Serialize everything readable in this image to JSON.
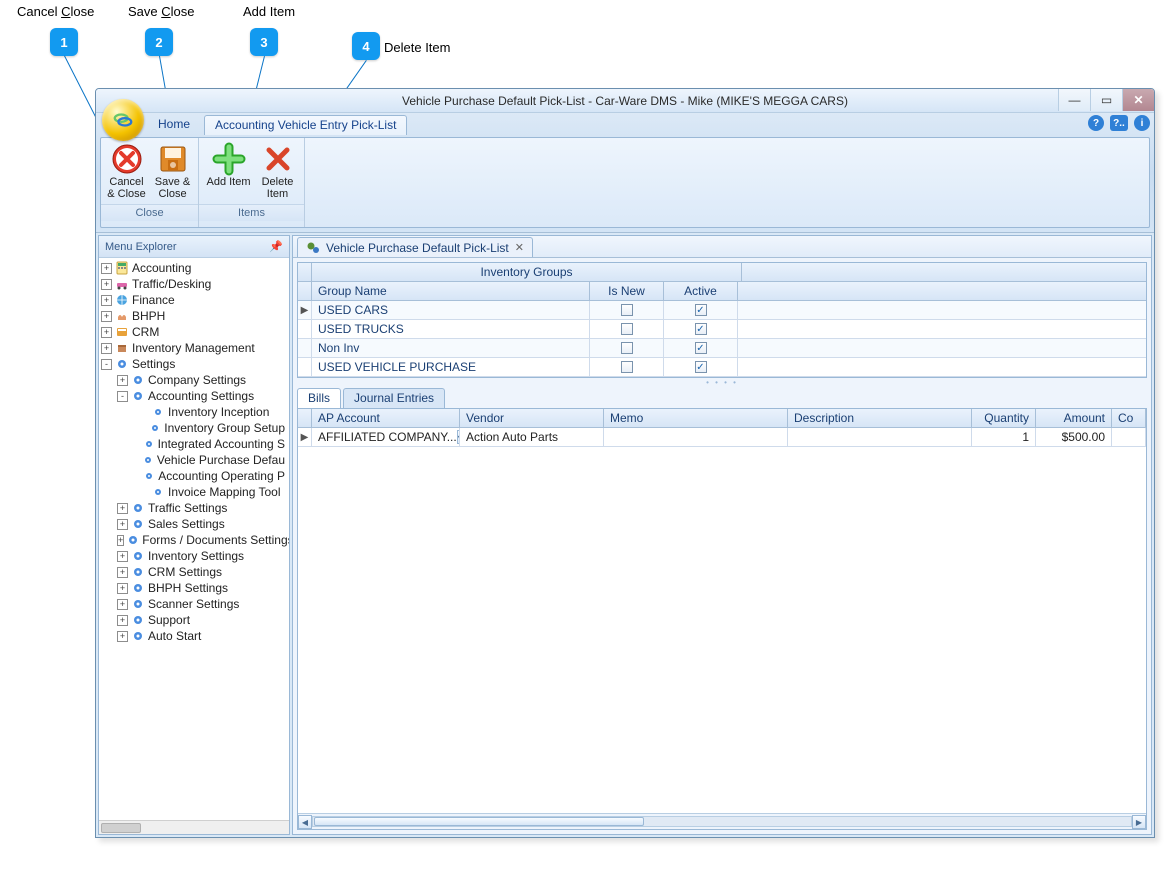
{
  "callouts": [
    {
      "num": "1",
      "label_pre": "Cancel ",
      "label_u": "C",
      "label_post": "lose"
    },
    {
      "num": "2",
      "label_pre": "Save ",
      "label_u": "C",
      "label_post": "lose"
    },
    {
      "num": "3",
      "label_pre": "",
      "label_u": "",
      "label_post": "Add Item"
    },
    {
      "num": "4",
      "label_pre": "",
      "label_u": "",
      "label_post": "Delete Item"
    }
  ],
  "window": {
    "title": "Vehicle Purchase Default Pick-List - Car-Ware DMS - Mike (MIKE'S MEGGA CARS)"
  },
  "ribbon": {
    "tabs": {
      "home": "Home",
      "active": "Accounting Vehicle Entry Pick-List"
    },
    "groups": [
      {
        "label": "Close",
        "buttons": [
          {
            "name": "cancel",
            "line1": "Cancel",
            "line2": "& Close"
          },
          {
            "name": "save",
            "line1": "Save &",
            "line2": "Close"
          }
        ]
      },
      {
        "label": "Items",
        "buttons": [
          {
            "name": "add",
            "line1": "Add Item",
            "line2": ""
          },
          {
            "name": "delete",
            "line1": "Delete",
            "line2": "Item"
          }
        ]
      }
    ]
  },
  "sidebar": {
    "title": "Menu Explorer",
    "nodes": [
      {
        "exp": "+",
        "icon": "calc",
        "label": "Accounting"
      },
      {
        "exp": "+",
        "icon": "car",
        "label": "Traffic/Desking"
      },
      {
        "exp": "+",
        "icon": "globe",
        "label": "Finance"
      },
      {
        "exp": "+",
        "icon": "hands",
        "label": "BHPH"
      },
      {
        "exp": "+",
        "icon": "crm",
        "label": "CRM"
      },
      {
        "exp": "+",
        "icon": "inv",
        "label": "Inventory Management"
      },
      {
        "exp": "-",
        "icon": "gear",
        "label": "Settings",
        "children": [
          {
            "exp": "+",
            "icon": "gear2",
            "label": "Company Settings"
          },
          {
            "exp": "-",
            "icon": "gear2",
            "label": "Accounting Settings",
            "children": [
              {
                "exp": "",
                "icon": "dot",
                "label": "Inventory Inception"
              },
              {
                "exp": "",
                "icon": "dot",
                "label": "Inventory Group Setup"
              },
              {
                "exp": "",
                "icon": "dot",
                "label": "Integrated Accounting S"
              },
              {
                "exp": "",
                "icon": "dot",
                "label": "Vehicle Purchase Defau"
              },
              {
                "exp": "",
                "icon": "dot",
                "label": "Accounting Operating P"
              },
              {
                "exp": "",
                "icon": "dot",
                "label": "Invoice Mapping Tool"
              }
            ]
          },
          {
            "exp": "+",
            "icon": "gear2",
            "label": "Traffic Settings"
          },
          {
            "exp": "+",
            "icon": "gear2",
            "label": "Sales Settings"
          },
          {
            "exp": "+",
            "icon": "gear2",
            "label": "Forms / Documents Settings"
          },
          {
            "exp": "+",
            "icon": "gear2",
            "label": "Inventory Settings"
          },
          {
            "exp": "+",
            "icon": "gear2",
            "label": "CRM Settings"
          },
          {
            "exp": "+",
            "icon": "gear2",
            "label": "BHPH Settings"
          },
          {
            "exp": "+",
            "icon": "gear2",
            "label": "Scanner Settings"
          },
          {
            "exp": "+",
            "icon": "gear2",
            "label": "Support"
          },
          {
            "exp": "+",
            "icon": "gear2",
            "label": "Auto Start"
          }
        ]
      }
    ]
  },
  "docTab": {
    "label": "Vehicle Purchase Default Pick-List"
  },
  "topGrid": {
    "merged": "Inventory Groups",
    "headers": {
      "name": "Group Name",
      "isnew": "Is New",
      "active": "Active"
    },
    "rows": [
      {
        "ind": "▶",
        "name": "USED CARS",
        "isnew": false,
        "active": true
      },
      {
        "ind": "",
        "name": "USED TRUCKS",
        "isnew": false,
        "active": true
      },
      {
        "ind": "",
        "name": "Non Inv",
        "isnew": false,
        "active": true
      },
      {
        "ind": "",
        "name": "USED VEHICLE PURCHASE",
        "isnew": false,
        "active": true
      }
    ]
  },
  "lowerTabs": {
    "bills": "Bills",
    "journal": "Journal Entries"
  },
  "lowerGrid": {
    "headers": {
      "ap": "AP Account",
      "vendor": "Vendor",
      "memo": "Memo",
      "desc": "Description",
      "qty": "Quantity",
      "amt": "Amount",
      "co": "Co"
    },
    "rows": [
      {
        "ind": "▶",
        "ap": "AFFILIATED COMPANY...",
        "vendor": "Action Auto Parts",
        "memo": "",
        "desc": "",
        "qty": "1",
        "amt": "$500.00"
      }
    ]
  }
}
